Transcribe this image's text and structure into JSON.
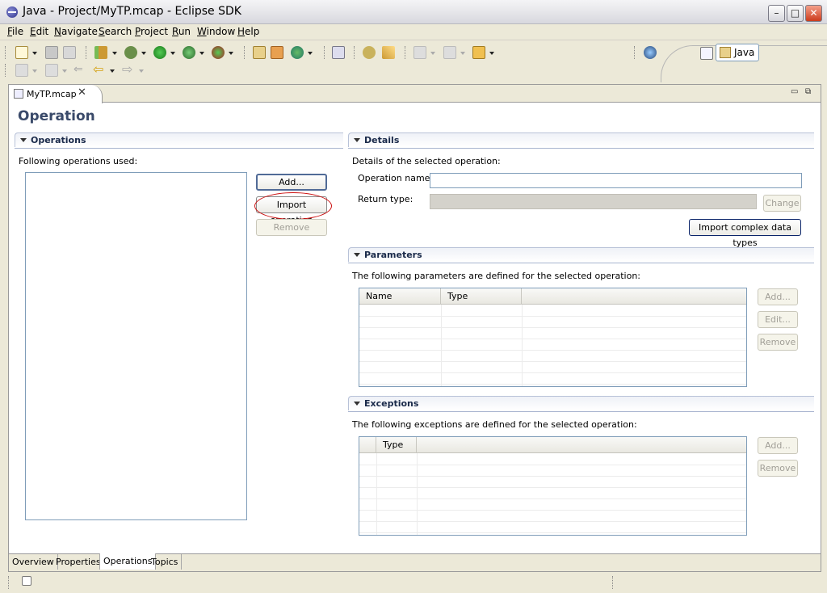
{
  "window": {
    "title": "Java - Project/MyTP.mcap - Eclipse SDK",
    "minimize": "–",
    "maximize": "□",
    "close": "✕"
  },
  "menu": [
    "File",
    "Edit",
    "Navigate",
    "Search",
    "Project",
    "Run",
    "Window",
    "Help"
  ],
  "perspective": {
    "label": "Java"
  },
  "editor": {
    "tab_label": "MyTP.mcap",
    "tab_close": "✕",
    "form_title": "Operation",
    "operations": {
      "title": "Operations",
      "description": "Following operations used:",
      "add_button": "Add...",
      "import_button": "Import operation",
      "remove_button": "Remove"
    },
    "details": {
      "title": "Details",
      "description": "Details of the selected operation:",
      "operation_name_label": "Operation name:",
      "operation_name_value": "",
      "return_type_label": "Return type:",
      "return_type_value": "",
      "change_button": "Change",
      "import_complex_button": "Import complex data types"
    },
    "parameters": {
      "title": "Parameters",
      "description": "The following parameters are defined for the selected operation:",
      "columns": [
        "Name",
        "Type"
      ],
      "add_button": "Add...",
      "edit_button": "Edit...",
      "remove_button": "Remove"
    },
    "exceptions": {
      "title": "Exceptions",
      "description": "The following exceptions are defined for the selected operation:",
      "columns": [
        "",
        "Type"
      ],
      "add_button": "Add...",
      "remove_button": "Remove"
    },
    "bottom_tabs": [
      "Overview",
      "Properties",
      "Operations",
      "Topics"
    ],
    "active_bottom_tab": "Operations"
  },
  "icons": {
    "app": "eclipse-icon",
    "toolbar": [
      "new-icon",
      "save-icon",
      "print-icon",
      "build-icon",
      "debug-icon",
      "run-icon",
      "run-external-icon",
      "coverage-icon",
      "new-package-icon",
      "new-class-icon",
      "refresh-icon",
      "open-type-icon",
      "open-task-icon",
      "search-icon",
      "back-icon",
      "forward-icon",
      "globe-icon"
    ]
  }
}
